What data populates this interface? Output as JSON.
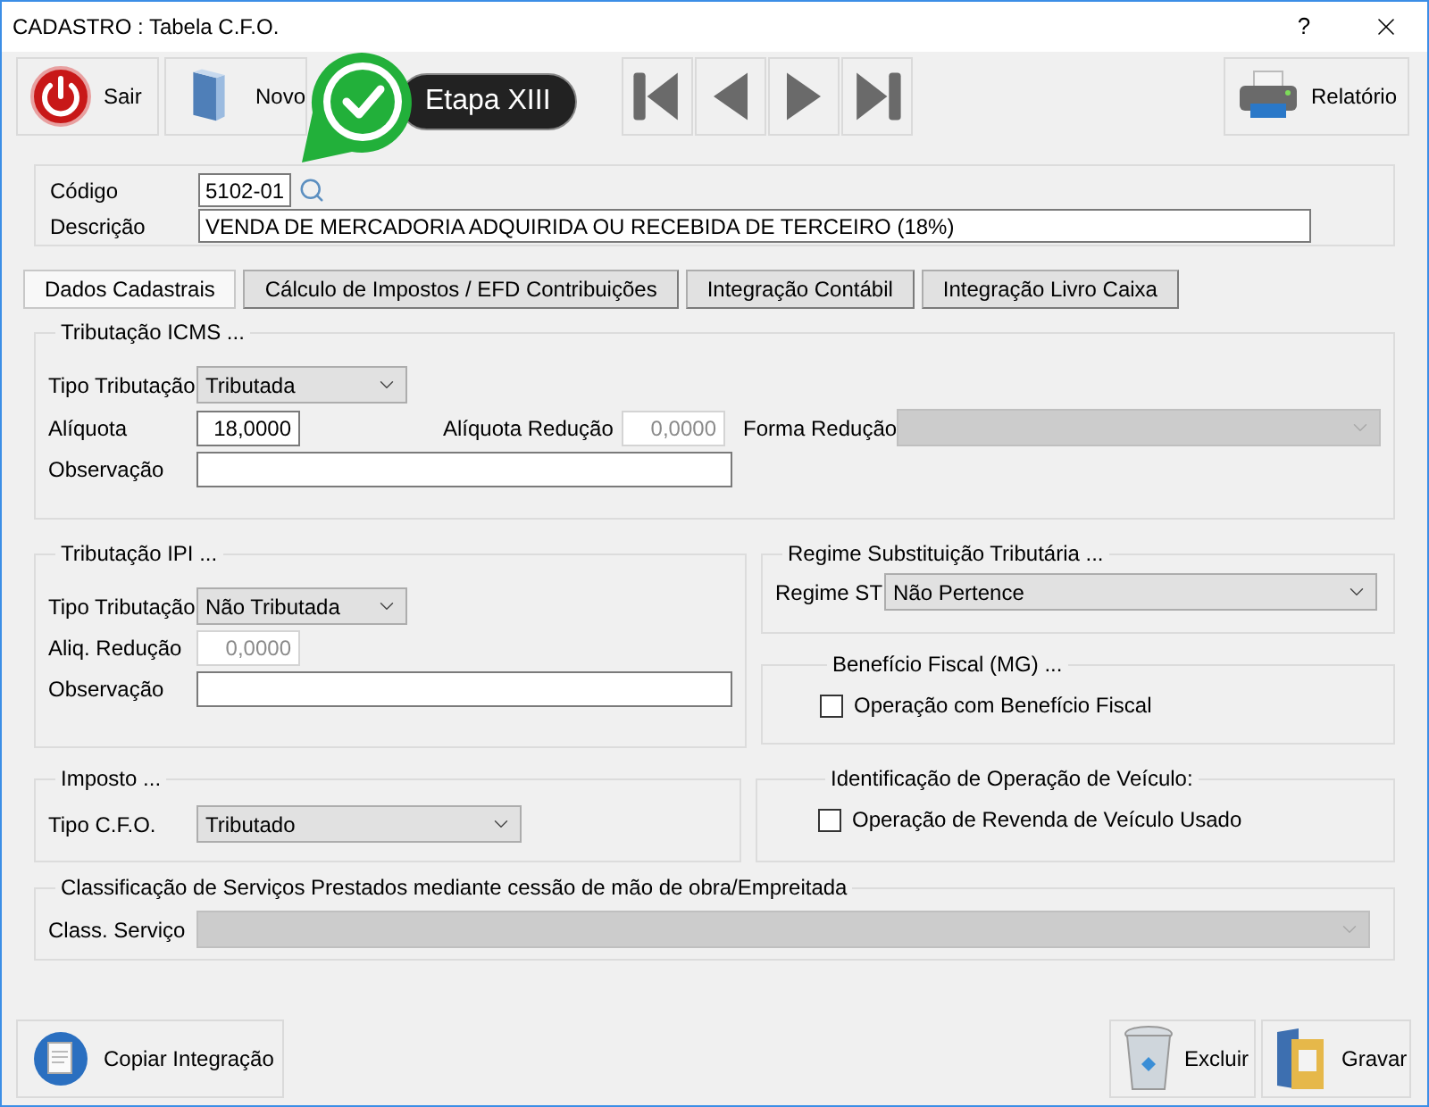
{
  "window": {
    "title": "CADASTRO : Tabela C.F.O.",
    "help": "?"
  },
  "toolbar": {
    "left": [
      {
        "kind": "exit",
        "label": "Sair"
      },
      {
        "kind": "new",
        "label": "Novo"
      }
    ],
    "report": {
      "label": "Relatório"
    }
  },
  "callout": {
    "label": "Etapa XIII"
  },
  "header": {
    "code": {
      "label": "Código",
      "value": "5102-01"
    },
    "description": {
      "label": "Descrição",
      "value": "VENDA DE MERCADORIA ADQUIRIDA OU RECEBIDA DE TERCEIRO (18%)"
    }
  },
  "tabs": [
    {
      "label": "Dados Cadastrais",
      "selected": true
    },
    {
      "label": "Cálculo de Impostos / EFD Contribuições",
      "selected": false
    },
    {
      "label": "Integração Contábil",
      "selected": false
    },
    {
      "label": "Integração Livro Caixa",
      "selected": false
    }
  ],
  "icms": {
    "title": "Tributação ICMS ...",
    "tipo": {
      "label": "Tipo Tributação",
      "value": "Tributada",
      "disabled": false
    },
    "aliquota": {
      "label": "Alíquota",
      "value": "18,0000",
      "disabled": false
    },
    "aliquota_reducao": {
      "label": "Alíquota Redução",
      "value": "0,0000",
      "disabled": true
    },
    "forma_reducao": {
      "label": "Forma Redução",
      "disabled": true
    },
    "observacao": {
      "label": "Observação",
      "disabled": false
    }
  },
  "ipi": {
    "title": "Tributação IPI ...",
    "tipo": {
      "label": "Tipo Tributação",
      "value": "Não Tributada",
      "disabled": false
    },
    "aliq_reducao": {
      "label": "Aliq. Redução",
      "value": "0,0000",
      "disabled": true
    },
    "observacao": {
      "label": "Observação",
      "disabled": false
    }
  },
  "regime_st": {
    "title": "Regime Substituição Tributária ...",
    "field": {
      "label": "Regime ST",
      "value": "Não Pertence",
      "disabled": false
    }
  },
  "beneficio": {
    "title": "Benefício Fiscal (MG) ...",
    "checkbox": {
      "label": "Operação com Benefício Fiscal",
      "checked": false
    }
  },
  "imposto": {
    "title": "Imposto ...",
    "field": {
      "label": "Tipo C.F.O.",
      "value": "Tributado",
      "disabled": false
    }
  },
  "veiculo": {
    "title": "Identificação de Operação de Veículo:",
    "checkbox": {
      "label": "Operação de Revenda de Veículo Usado",
      "checked": false
    }
  },
  "servico": {
    "title": "Classificação de Serviços Prestados mediante cessão de mão de obra/Empreitada",
    "field": {
      "label": "Class. Serviço",
      "disabled": true
    }
  },
  "footer": {
    "copy": {
      "label": "Copiar Integração"
    },
    "delete": {
      "label": "Excluir"
    },
    "save": {
      "label": "Gravar"
    }
  }
}
